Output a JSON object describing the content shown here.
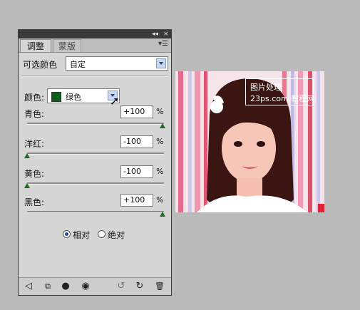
{
  "panel": {
    "title_buttons": [
      "◂◂",
      "×"
    ],
    "tabs": [
      {
        "label": "调整"
      },
      {
        "label": "蒙版"
      }
    ],
    "menu_icon": "panel-menu-icon"
  },
  "selective_color": {
    "title": "可选颜色",
    "preset_value": "自定",
    "colors_label": "颜色:",
    "colors_value": "绿色",
    "colors_swatch": "#0b5f16",
    "sliders": [
      {
        "label": "青色:",
        "value": "+100",
        "unit": "%",
        "level": 1.0
      },
      {
        "label": "洋红:",
        "value": "-100",
        "unit": "%",
        "level": 0.0
      },
      {
        "label": "黄色:",
        "value": "-100",
        "unit": "%",
        "level": 0.0
      },
      {
        "label": "黑色:",
        "value": "+100",
        "unit": "%",
        "level": 1.0
      }
    ],
    "method": {
      "relative": "相对",
      "absolute": "绝对",
      "selected": "relative"
    }
  },
  "bottom_icons": [
    "back-arrow-icon",
    "clip-layer-icon",
    "view-previous-icon",
    "eye-icon",
    "reset-previous-icon",
    "reset-icon",
    "trash-icon"
  ],
  "image": {
    "watermark_line1": "图片处理",
    "watermark_line2": "23ps.com 教程网"
  }
}
